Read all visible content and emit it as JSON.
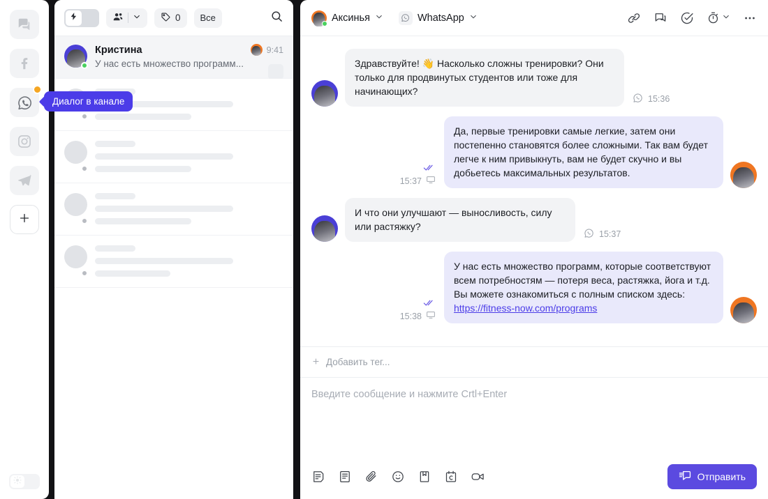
{
  "colors": {
    "accent": "#4b3ce8",
    "send_button": "#5b4ae0",
    "badge_orange": "#f5a623",
    "avatar_blue": "#4a3fd6",
    "avatar_orange": "#ef7622",
    "bubble_in": "#f2f3f5",
    "bubble_out": "#e9e9fb",
    "online_green": "#4ad15f"
  },
  "rail": {
    "items": [
      {
        "icon": "chat-bubbles-icon",
        "name": "channel-chat",
        "active": false,
        "badge": false
      },
      {
        "icon": "facebook-icon",
        "name": "channel-facebook",
        "active": false,
        "badge": false
      },
      {
        "icon": "whatsapp-icon",
        "name": "channel-whatsapp",
        "active": true,
        "badge": true
      },
      {
        "icon": "instagram-icon",
        "name": "channel-instagram",
        "active": false,
        "badge": false
      },
      {
        "icon": "telegram-icon",
        "name": "channel-telegram",
        "active": false,
        "badge": false
      }
    ],
    "add_label": "+",
    "theme_toggle_icon": "sun-icon"
  },
  "tooltip": {
    "text": "Диалог в канале"
  },
  "list_toolbar": {
    "lightning_toggle_icon": "lightning-icon",
    "assignee_icon": "users-icon",
    "assignee_chevron_icon": "chevron-down-icon",
    "tag_icon": "tag-icon",
    "tag_count": "0",
    "filter_label": "Все",
    "search_icon": "search-icon"
  },
  "chat_list": {
    "active": {
      "name": "Кристина",
      "preview": "У нас есть множество программ...",
      "time": "9:41",
      "online": true
    },
    "skeletons": [
      {
        "id": 1
      },
      {
        "id": 2
      },
      {
        "id": 3
      },
      {
        "id": 4
      }
    ]
  },
  "chat_header": {
    "user_name": "Аксинья",
    "user_chevron_icon": "chevron-down-icon",
    "channel_name": "WhatsApp",
    "channel_icon": "whatsapp-icon",
    "channel_chevron_icon": "chevron-down-icon",
    "actions": [
      {
        "name": "link-icon",
        "label": "link"
      },
      {
        "name": "comment-icon",
        "label": "comment"
      },
      {
        "name": "check-circle-icon",
        "label": "resolve"
      },
      {
        "name": "stopwatch-icon",
        "label": "snooze"
      },
      {
        "name": "more-options-icon",
        "label": "more"
      }
    ]
  },
  "messages": [
    {
      "id": "m1",
      "direction": "in",
      "text": "Здравствуйте! 👋 Насколько сложны тренировки? Они только для продвинутых студентов или тоже для начинающих?",
      "time": "15:36",
      "channel_icon": "whatsapp-icon"
    },
    {
      "id": "m2",
      "direction": "out",
      "text": "Да, первые тренировки самые легкие, затем они постепенно становятся более сложными. Так вам будет легче к ним привыкнуть, вам не будет скучно и вы добьетесь максимальных результатов.",
      "time": "15:37",
      "status_icon": "double-check-icon",
      "device_icon": "desktop-icon"
    },
    {
      "id": "m3",
      "direction": "in",
      "text": "И что они улучшают — выносливость, силу или растяжку?",
      "time": "15:37",
      "channel_icon": "whatsapp-icon"
    },
    {
      "id": "m4",
      "direction": "out",
      "text": "У нас есть множество программ, которые соответствуют всем потребностям — потеря веса, растяжка, йога и т.д. Вы можете ознакомиться с полным списком здесь:",
      "link": "https://fitness-now.com/programs",
      "time": "15:38",
      "status_icon": "double-check-icon",
      "device_icon": "desktop-icon"
    }
  ],
  "tag_bar": {
    "add_tag_label": "Добавить тег...",
    "plus_icon": "plus-icon"
  },
  "composer": {
    "placeholder": "Введите сообщение и нажмите Crtl+Enter",
    "icons": [
      {
        "name": "note-icon"
      },
      {
        "name": "knowledge-base-icon"
      },
      {
        "name": "attachment-icon"
      },
      {
        "name": "emoji-icon"
      },
      {
        "name": "saved-reply-icon"
      },
      {
        "name": "calendar-icon"
      },
      {
        "name": "video-call-icon"
      }
    ],
    "send_label": "Отправить",
    "send_icon": "send-message-icon"
  }
}
